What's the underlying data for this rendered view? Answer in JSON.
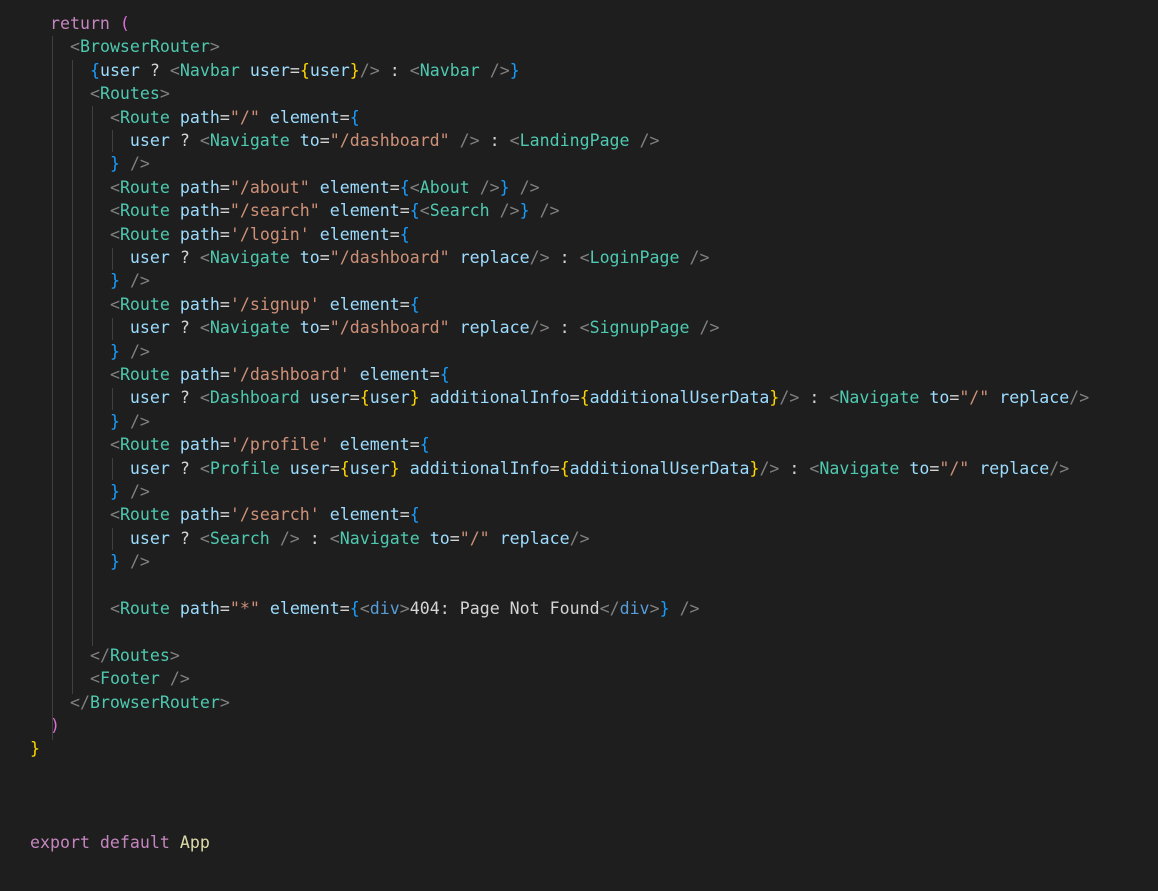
{
  "editor": {
    "theme_colors": {
      "background": "#1e1e1e",
      "keyword_control": "#c586c0",
      "component_tag": "#4ec9b0",
      "html_tag": "#569cd6",
      "attribute": "#9cdcfe",
      "string": "#ce9178",
      "bracket_gold": "#ffd700",
      "bracket_blue": "#179fff",
      "punctuation": "#808080",
      "text": "#d4d4d4"
    },
    "tokens": {
      "return_kw": "return",
      "open_paren": " (",
      "close_paren": ")",
      "close_brace": "}",
      "export_line_kw": "export default",
      "export_name": "App",
      "browser_router": "BrowserRouter",
      "navbar": "Navbar",
      "routes": "Routes",
      "route": "Route",
      "navigate": "Navigate",
      "landing": "LandingPage",
      "about": "About",
      "search": "Search",
      "login": "LoginPage",
      "signup": "SignupPage",
      "dashboard": "Dashboard",
      "profile": "Profile",
      "footer": "Footer",
      "div": "div",
      "attr_user": "user",
      "attr_path": "path",
      "attr_element": "element",
      "attr_to": "to",
      "attr_replace": "replace",
      "attr_additional": "additionalInfo",
      "var_user": "user",
      "var_additional": "additionalUserData",
      "str_root": "\"/\"",
      "str_dashboard_dq": "\"/dashboard\"",
      "str_about": "\"/about\"",
      "str_search_dq": "\"/search\"",
      "str_login": "'/login'",
      "str_signup": "'/signup'",
      "str_dashboard_sq": "'/dashboard'",
      "str_profile": "'/profile'",
      "str_search_sq": "'/search'",
      "str_star": "\"*\"",
      "not_found_text": "404: Page Not Found",
      "ternary_q": " ? ",
      "ternary_colon": " : "
    }
  }
}
